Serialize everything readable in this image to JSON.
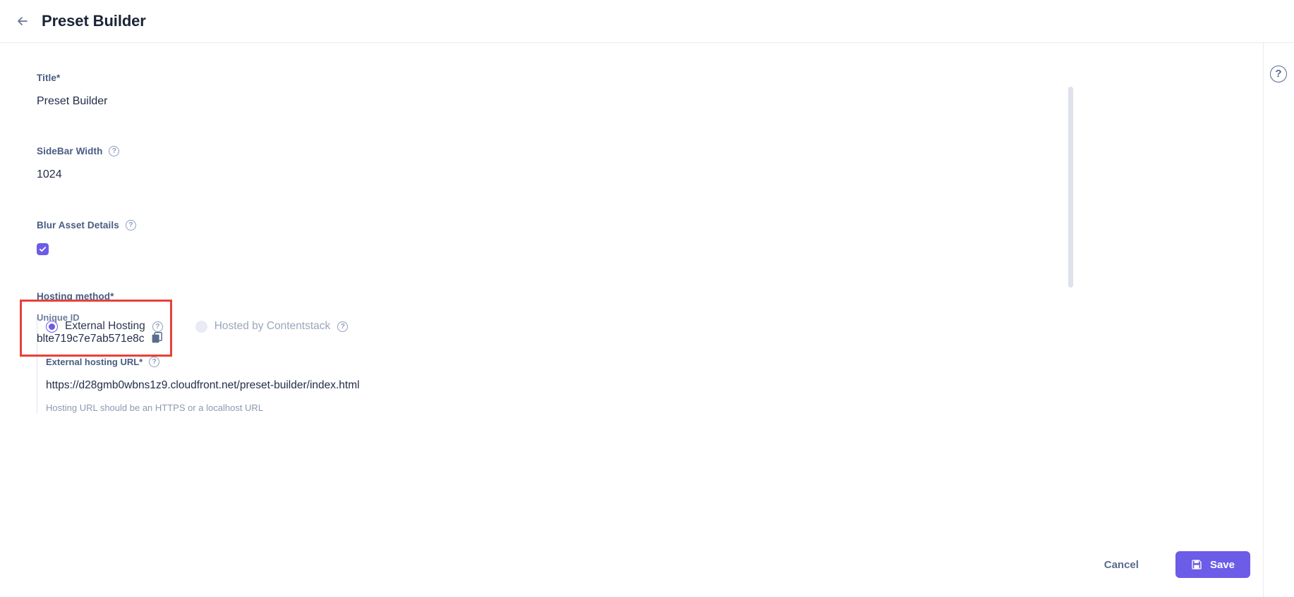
{
  "header": {
    "back_icon": "arrow-left-icon",
    "title": "Preset Builder"
  },
  "form": {
    "title_field": {
      "label": "Title*",
      "value": "Preset Builder"
    },
    "sidebar_width_field": {
      "label": "SideBar Width",
      "help_icon": "question-mark-icon",
      "value": "1024"
    },
    "blur_asset_field": {
      "label": "Blur Asset Details",
      "help_icon": "question-mark-icon",
      "checked": true
    },
    "unique_id_field": {
      "label": "Unique ID",
      "value": "blte719c7e7ab571e8c",
      "copy_icon": "copy-icon",
      "highlight_color": "#e8403a"
    },
    "hosting_method": {
      "label": "Hosting method*",
      "options": [
        {
          "label": "External Hosting",
          "selected": true,
          "disabled": false,
          "help_icon": "question-mark-icon"
        },
        {
          "label": "Hosted by Contentstack",
          "selected": false,
          "disabled": true,
          "help_icon": "question-mark-icon"
        }
      ]
    },
    "external_url_field": {
      "label": "External hosting URL*",
      "help_icon": "question-mark-icon",
      "value": "https://d28gmb0wbns1z9.cloudfront.net/preset-builder/index.html",
      "hint": "Hosting URL should be an HTTPS or a localhost URL"
    }
  },
  "help_rail": {
    "help_icon": "question-mark-circle-icon"
  },
  "footer": {
    "cancel_label": "Cancel",
    "save_label": "Save",
    "save_icon": "floppy-disk-save-icon",
    "accent_color": "#6c5ce7"
  }
}
